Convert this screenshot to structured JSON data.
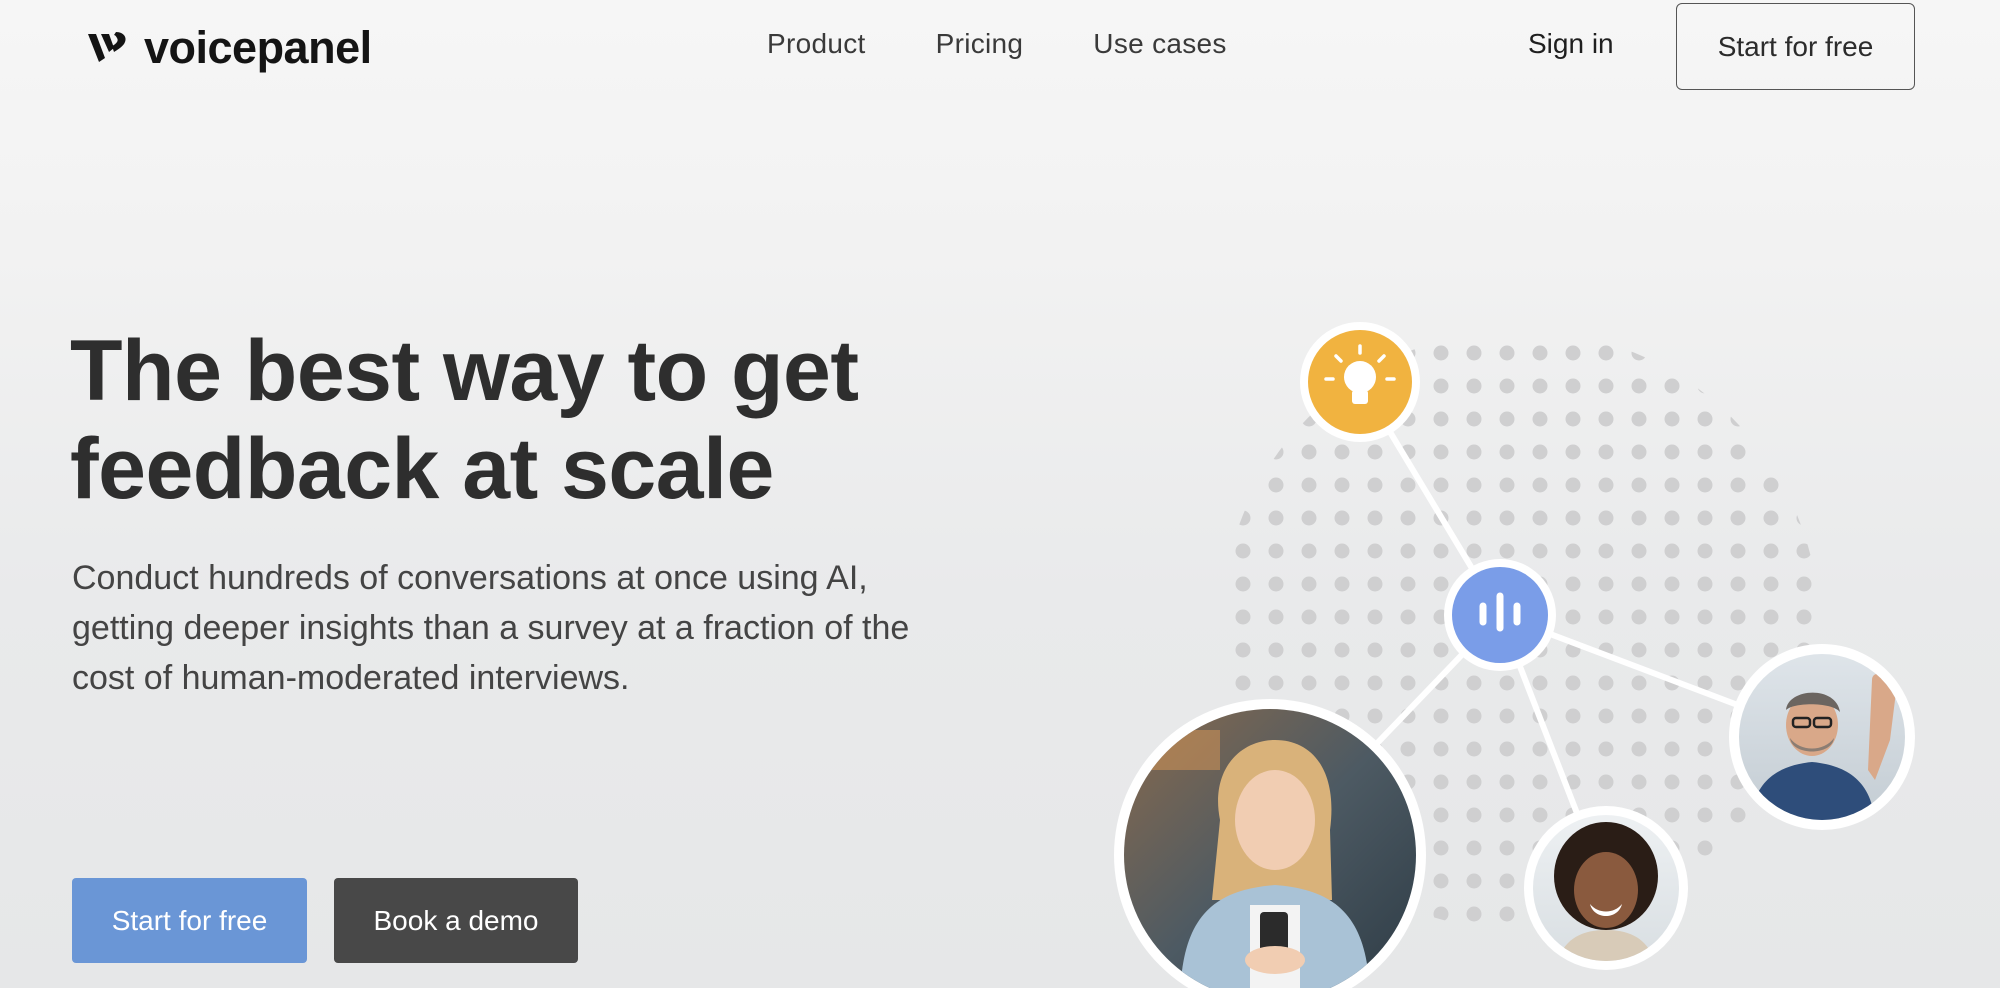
{
  "brand": {
    "name": "voicepanel",
    "logo_icon": "voicepanel-v-logo"
  },
  "nav": {
    "items": [
      {
        "label": "Product"
      },
      {
        "label": "Pricing"
      },
      {
        "label": "Use cases"
      }
    ],
    "sign_in": "Sign in",
    "cta": "Start for free"
  },
  "hero": {
    "title_line1": "The best way to get",
    "title_line2": "feedback at scale",
    "subtitle": "Conduct hundreds of conversations at once using AI, getting deeper insights than a survey at a fraction of the cost of human-moderated interviews.",
    "primary_button": "Start for free",
    "secondary_button": "Book a demo"
  },
  "illustration": {
    "icons": [
      "lightbulb-icon",
      "voice-waveform-icon"
    ],
    "colors": {
      "bulb_bg": "#f1b340",
      "voice_bg": "#7a9de8",
      "dots": "#cfcfd0",
      "lines": "#ffffff"
    },
    "avatars": [
      "woman-with-phone-avatar",
      "man-waving-avatar",
      "smiling-woman-avatar"
    ]
  },
  "colors": {
    "primary": "#6a96d6",
    "dark_button": "#484848",
    "text": "#2e2e2e"
  }
}
